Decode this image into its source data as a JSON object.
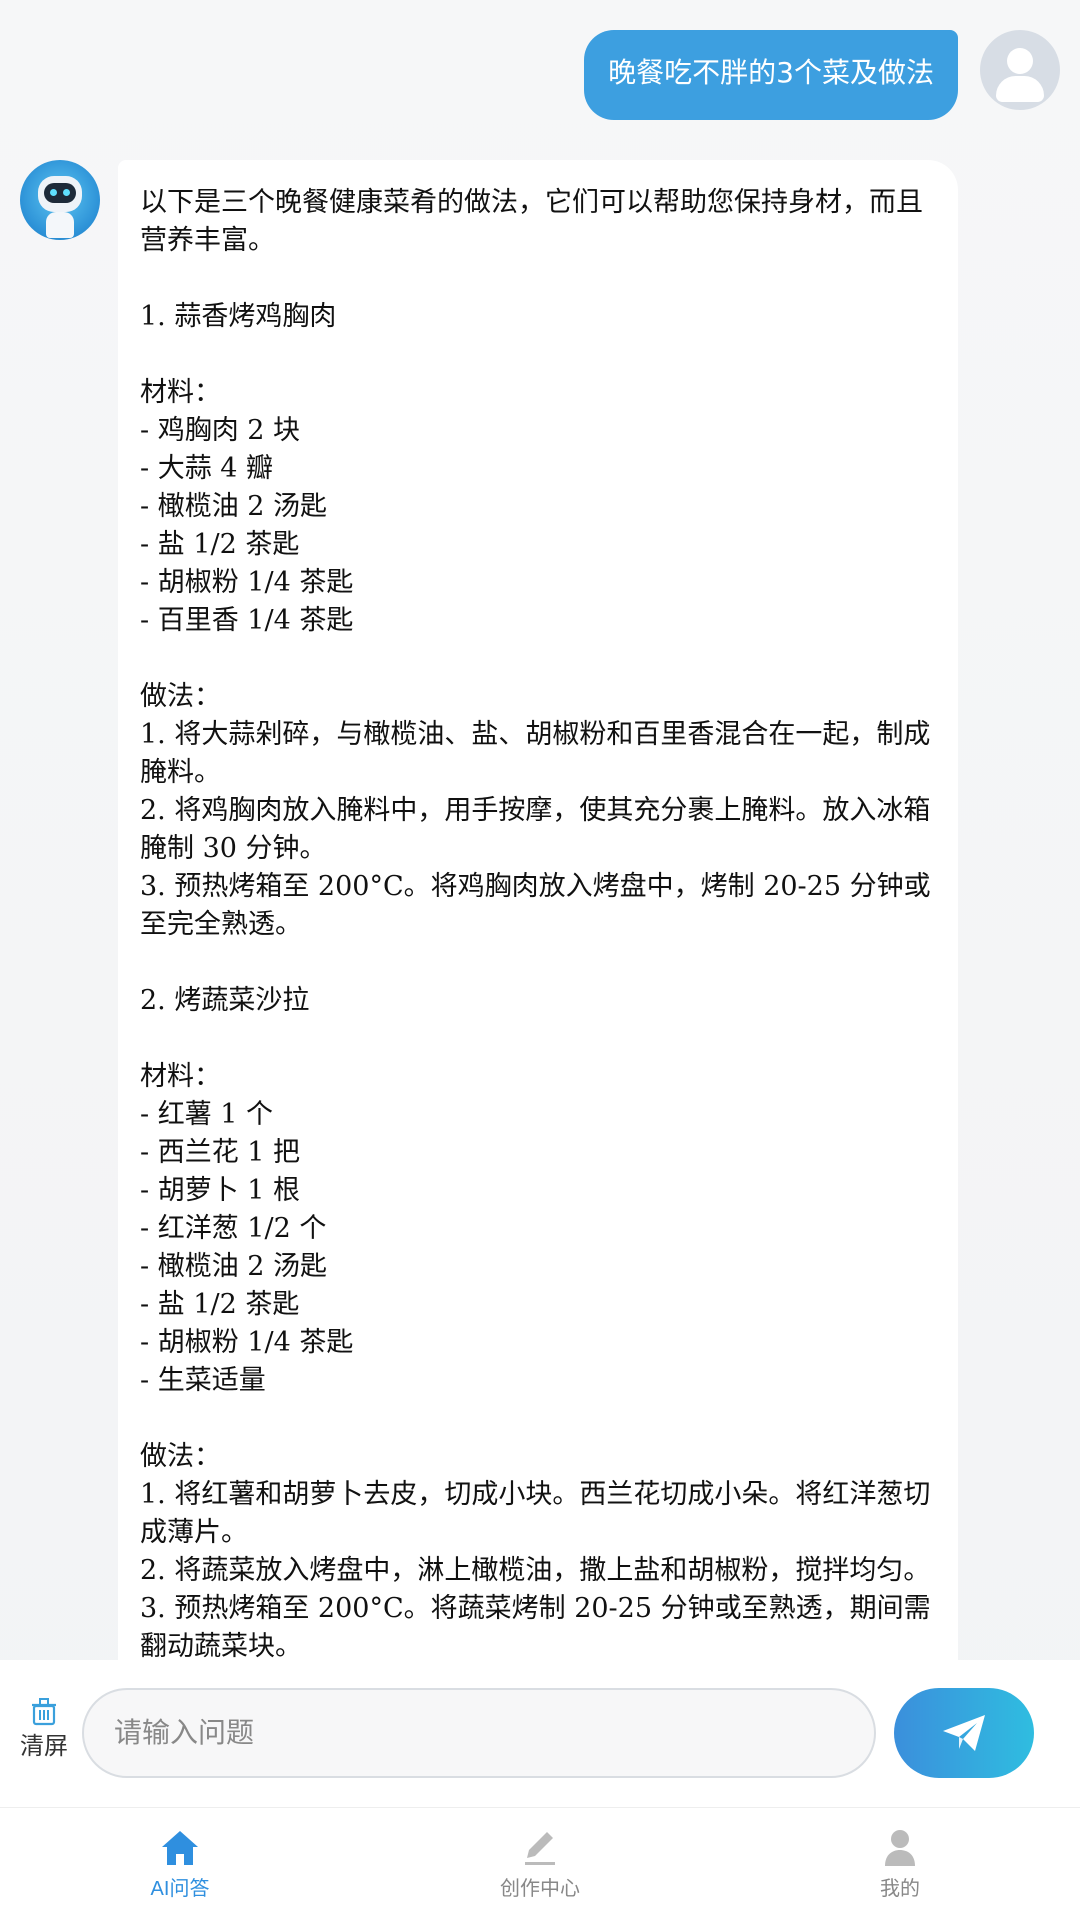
{
  "user_message": "晚餐吃不胖的3个菜及做法",
  "bot_message": "以下是三个晚餐健康菜肴的做法，它们可以帮助您保持身材，而且营养丰富。\n\n1. 蒜香烤鸡胸肉\n\n材料：\n- 鸡胸肉 2 块\n- 大蒜 4 瓣\n- 橄榄油 2 汤匙\n- 盐 1/2 茶匙\n- 胡椒粉 1/4 茶匙\n- 百里香 1/4 茶匙\n\n做法：\n1. 将大蒜剁碎，与橄榄油、盐、胡椒粉和百里香混合在一起，制成腌料。\n2. 将鸡胸肉放入腌料中，用手按摩，使其充分裹上腌料。放入冰箱腌制 30 分钟。\n3. 预热烤箱至 200°C。将鸡胸肉放入烤盘中，烤制 20-25 分钟或至完全熟透。\n\n2. 烤蔬菜沙拉\n\n材料：\n- 红薯 1 个\n- 西兰花 1 把\n- 胡萝卜 1 根\n- 红洋葱 1/2 个\n- 橄榄油 2 汤匙\n- 盐 1/2 茶匙\n- 胡椒粉 1/4 茶匙\n- 生菜适量\n\n做法：\n1. 将红薯和胡萝卜去皮，切成小块。西兰花切成小朵。将红洋葱切成薄片。\n2. 将蔬菜放入烤盘中，淋上橄榄油，撒上盐和胡椒粉，搅拌均匀。\n3. 预热烤箱至 200°C。将蔬菜烤制 20-25 分钟或至熟透，期间需翻动蔬菜块。",
  "input": {
    "placeholder": "请输入问题",
    "value": ""
  },
  "clear_button": {
    "label": "清屏",
    "icon": "trash-icon"
  },
  "send_button": {
    "icon": "paper-plane-icon"
  },
  "tabs": [
    {
      "label": "AI问答",
      "icon": "home-icon",
      "active": true,
      "color": "#2f8fdf"
    },
    {
      "label": "创作中心",
      "icon": "pencil-icon",
      "active": false,
      "color": "#bbbbbb"
    },
    {
      "label": "我的",
      "icon": "person-icon",
      "active": false,
      "color": "#bbbbbb"
    }
  ],
  "colors": {
    "accent": "#3d9fe0",
    "tab_active": "#2f8fdf",
    "tab_inactive": "#bbbbbb"
  }
}
